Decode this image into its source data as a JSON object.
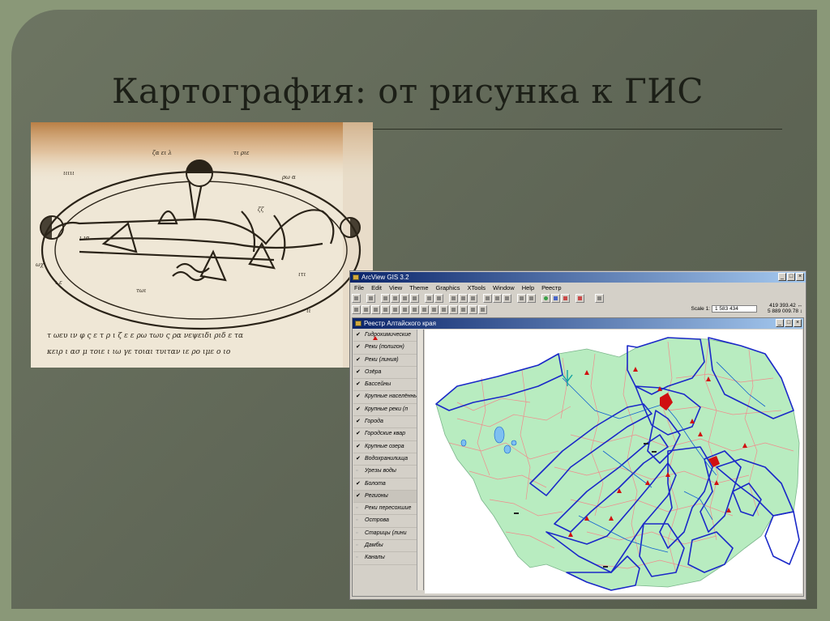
{
  "slide": {
    "title": "Картография: от рисунка к ГИС"
  },
  "manuscript": {
    "description_alt": "",
    "text_lines": [
      "τ ωευ ιν φ ς ε τ ρ ι ζ ε ε ρω τωυ ς ρα νεψειδι ριδ ε τα",
      "κειρ ι ασ μ τοιε ι ιω γε τοιαι τυιταν ιε ρο ιμε ο ιο"
    ]
  },
  "arcview": {
    "title": "ArcView GIS 3.2",
    "menu": [
      "File",
      "Edit",
      "View",
      "Theme",
      "Graphics",
      "XTools",
      "Window",
      "Help",
      "Реестр"
    ],
    "scale_label": "Scale 1:",
    "scale_value": "1 583 434",
    "coords": [
      "419 393.42 ↔",
      "5 889 009.78 ↕"
    ],
    "view_title": "Реестр Алтайского края",
    "window_buttons": [
      "_",
      "□",
      "×"
    ],
    "layers": [
      {
        "name": "Гидрохимические",
        "checked": true,
        "symbol": "red-triangle"
      },
      {
        "name": "Реки (полигон)",
        "checked": true
      },
      {
        "name": "Реки (линия)",
        "checked": true
      },
      {
        "name": "Озёра",
        "checked": true
      },
      {
        "name": "Бассейны",
        "checked": true
      },
      {
        "name": "Крупные населённые",
        "checked": true
      },
      {
        "name": "Крупные реки (п",
        "checked": true
      },
      {
        "name": "Города",
        "checked": true
      },
      {
        "name": "Городские квар",
        "checked": true
      },
      {
        "name": "Крупные озера",
        "checked": true
      },
      {
        "name": "Водохранилища",
        "checked": true
      },
      {
        "name": "Урезы воды",
        "checked": false
      },
      {
        "name": "Болота",
        "checked": true
      },
      {
        "name": "Регионы",
        "checked": true,
        "active": true
      },
      {
        "name": "Реки пересохшие",
        "checked": false
      },
      {
        "name": "Острова",
        "checked": false
      },
      {
        "name": "Старицы (лини",
        "checked": false
      },
      {
        "name": "Дамбы",
        "checked": false
      },
      {
        "name": "Каналы",
        "checked": false
      }
    ],
    "colors": {
      "map_fill": "#b8ecc0",
      "region_border": "#f08c8c",
      "basin_border": "#1a28c8",
      "river": "#1060d0",
      "city": "#d01010"
    }
  }
}
